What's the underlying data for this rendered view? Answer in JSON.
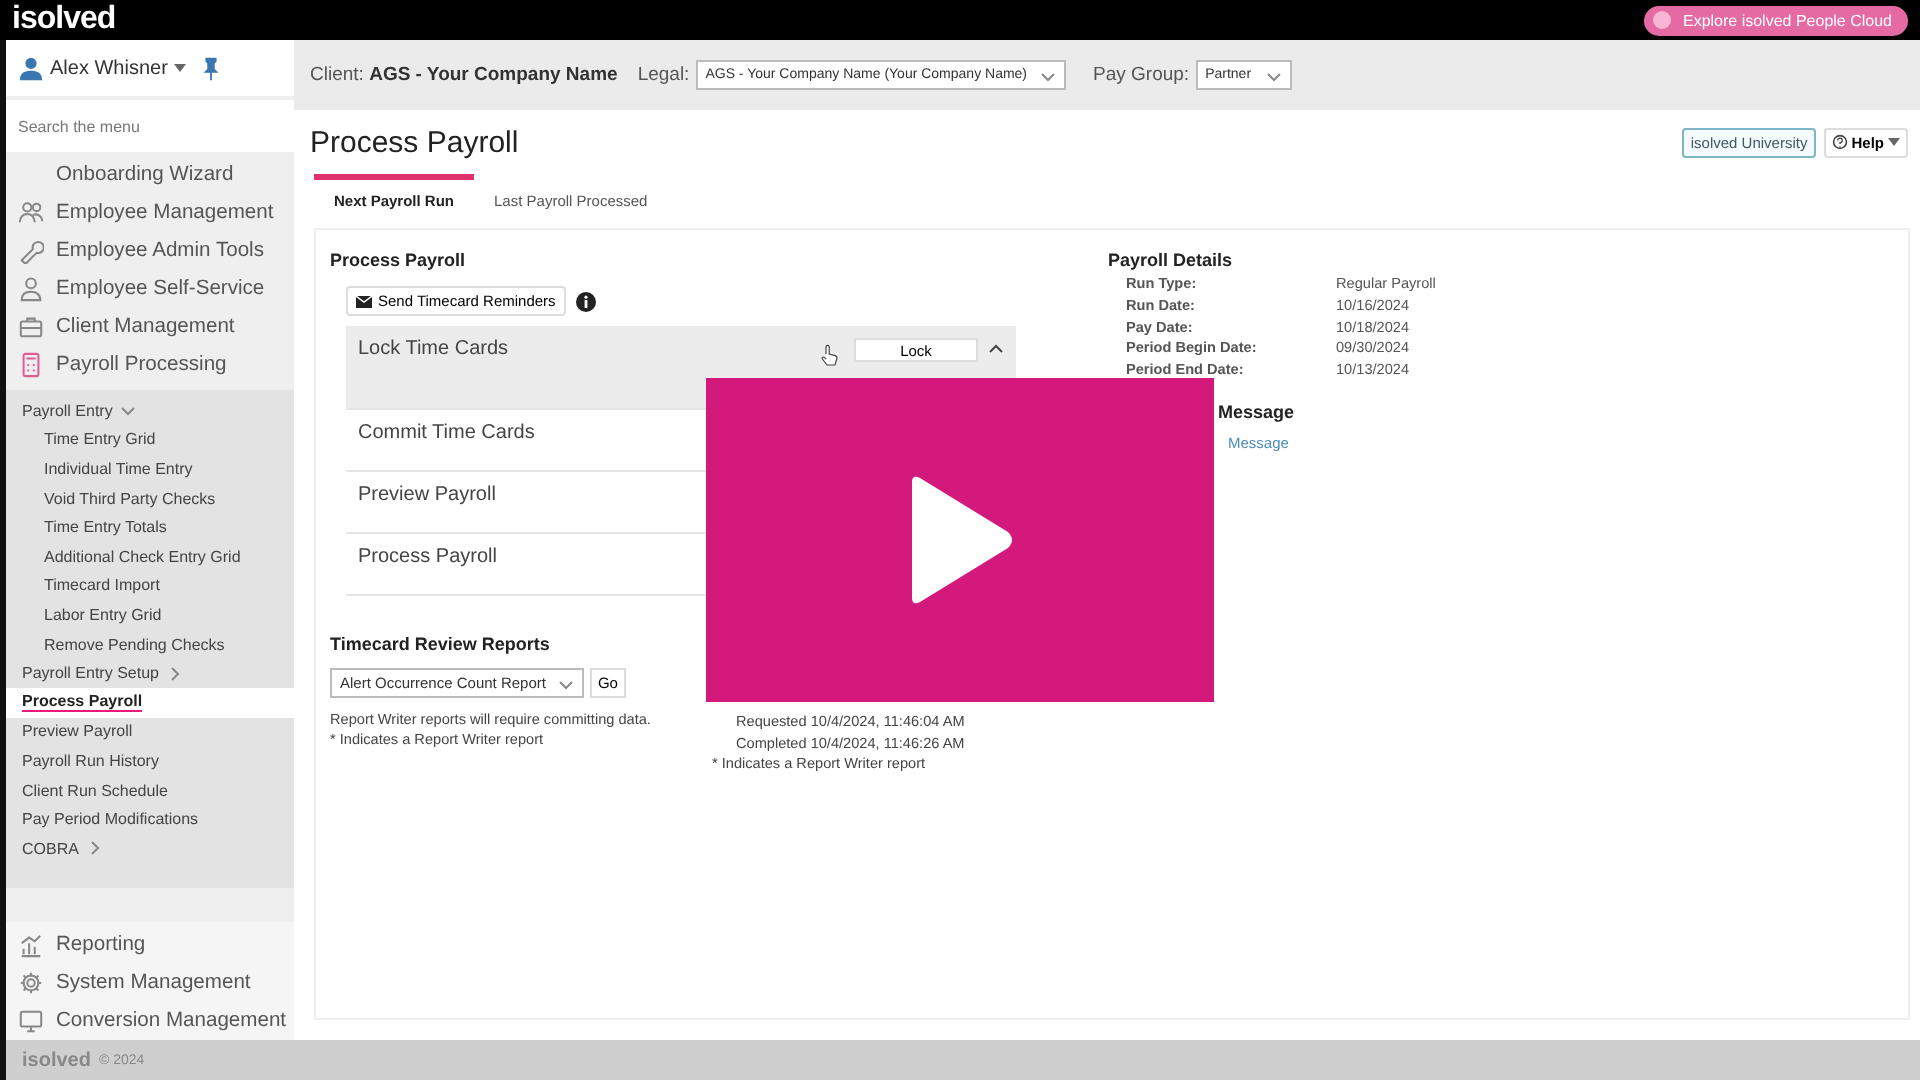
{
  "top_bar": {
    "logo": "isolved",
    "promo_button": "Explore isolved People Cloud"
  },
  "sidebar": {
    "user": "Alex Whisner",
    "search": {
      "placeholder": "Search the menu"
    },
    "items": [
      {
        "label": "Onboarding Wizard",
        "kind": "none"
      },
      {
        "label": "Employee Management",
        "kind": "people"
      },
      {
        "label": "Employee Admin Tools",
        "kind": "wrench"
      },
      {
        "label": "Employee Self-Service",
        "kind": "person"
      },
      {
        "label": "Client Management",
        "kind": "briefcase"
      },
      {
        "label": "Payroll Processing",
        "kind": "calculator"
      }
    ],
    "submenu": [
      {
        "label": "Payroll Entry",
        "selected": false,
        "expanded": true,
        "children": [
          {
            "label": "Time Entry Grid",
            "selected": false
          },
          {
            "label": "Individual Time Entry",
            "selected": false
          },
          {
            "label": "Void Third Party Checks",
            "selected": false
          },
          {
            "label": "Time Entry Totals",
            "selected": false
          },
          {
            "label": "Additional Check Entry Grid",
            "selected": false
          },
          {
            "label": "Timecard Import",
            "selected": false
          },
          {
            "label": "Labor Entry Grid",
            "selected": false
          },
          {
            "label": "Remove Pending Checks",
            "selected": false
          }
        ]
      },
      {
        "label": "Payroll Entry Setup",
        "selected": false,
        "expanded": false
      },
      {
        "label": "Process Payroll",
        "selected": true
      },
      {
        "label": "Preview Payroll",
        "selected": false
      },
      {
        "label": "Payroll Run History",
        "selected": false
      },
      {
        "label": "Client Run Schedule",
        "selected": false
      },
      {
        "label": "Pay Period Modifications",
        "selected": false
      },
      {
        "label": "COBRA",
        "selected": false,
        "expanded": false
      }
    ],
    "bottom_items": [
      {
        "label": "Reporting",
        "kind": "chart"
      },
      {
        "label": "System Management",
        "kind": "gear"
      },
      {
        "label": "Conversion Management",
        "kind": "monitor"
      }
    ]
  },
  "footer": {
    "logo": "isolved",
    "copyright": "© 2024"
  },
  "header": {
    "client_label": "Client:",
    "client": "AGS - Your Company Name",
    "legal_label": "Legal:",
    "legal": "AGS - Your Company Name (Your Company Name)",
    "pay_group_label": "Pay Group:",
    "pay_group": "Partner"
  },
  "page": {
    "title": "Process Payroll",
    "buttons": [
      "isolved University",
      "Help"
    ],
    "tabs": [
      {
        "label": "Next Payroll Run",
        "selected": true
      },
      {
        "label": "Last Payroll Processed",
        "selected": false
      }
    ]
  },
  "process": {
    "heading": "Process Payroll",
    "reminder_button": "Send Timecard Reminders",
    "steps": [
      {
        "label": "Lock Time Cards",
        "expanded": true,
        "button": "Lock"
      },
      {
        "label": "Commit Time Cards",
        "expanded": false
      },
      {
        "label": "Preview Payroll",
        "expanded": false
      },
      {
        "label": "Process Payroll",
        "expanded": false
      }
    ]
  },
  "timecard_reports": {
    "heading": "Timecard Review Reports",
    "select": "Alert Occurrence Count Report",
    "go": "Go",
    "notes": [
      "Report Writer reports will require committing data.",
      "* Indicates a Report Writer report"
    ]
  },
  "preview_reports": {
    "lines": [
      "Requested 10/4/2024, 11:46:04 AM",
      "Completed 10/4/2024, 11:46:26 AM"
    ],
    "note": "* Indicates a Report Writer report"
  },
  "payroll_details": {
    "heading": "Payroll Details",
    "rows": [
      {
        "label": "Run Type:",
        "value": "Regular Payroll"
      },
      {
        "label": "Run Date:",
        "value": "10/16/2024"
      },
      {
        "label": "Pay Date:",
        "value": "10/18/2024"
      },
      {
        "label": "Period Begin Date:",
        "value": "09/30/2024"
      },
      {
        "label": "Period End Date:",
        "value": "10/13/2024"
      }
    ]
  },
  "check_stub": {
    "heading": "Message",
    "link": "Message"
  }
}
